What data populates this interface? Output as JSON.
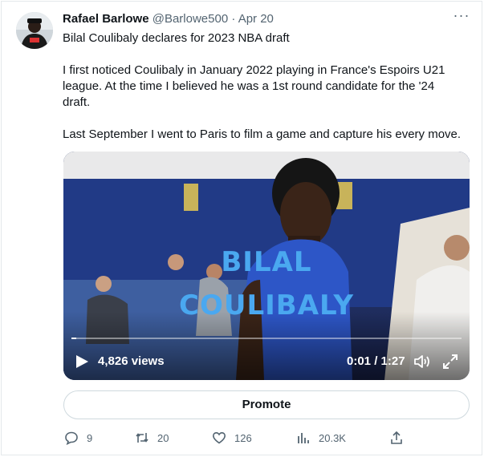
{
  "author": {
    "name": "Rafael Barlowe",
    "handle": "@Barlowe500",
    "separator": "·",
    "date": "Apr 20"
  },
  "more_label": "···",
  "tweet": {
    "line1": "Bilal Coulibaly declares for 2023 NBA draft",
    "para2_line1": "I first noticed Coulibaly in January 2022 playing in France's Espoirs U21",
    "para2_line2": "league. At the time I believed he was a 1st round candidate for the '24",
    "para2_line3": "draft.",
    "para3": "Last September I went to Paris to film a game and capture his every move."
  },
  "video": {
    "overlay_line1": "BILAL",
    "overlay_line2": "COULIBALY",
    "views": "4,826 views",
    "time": "0:01 / 1:27",
    "progress_fraction": 0.012,
    "overlay_color": "#4aa8f0"
  },
  "promote_label": "Promote",
  "actions": {
    "replies": "9",
    "retweets": "20",
    "likes": "126",
    "views": "20.3K"
  },
  "icons": [
    "reply-icon",
    "retweet-icon",
    "like-icon",
    "views-chart-icon",
    "share-icon",
    "play-icon",
    "volume-icon",
    "fullscreen-icon"
  ]
}
